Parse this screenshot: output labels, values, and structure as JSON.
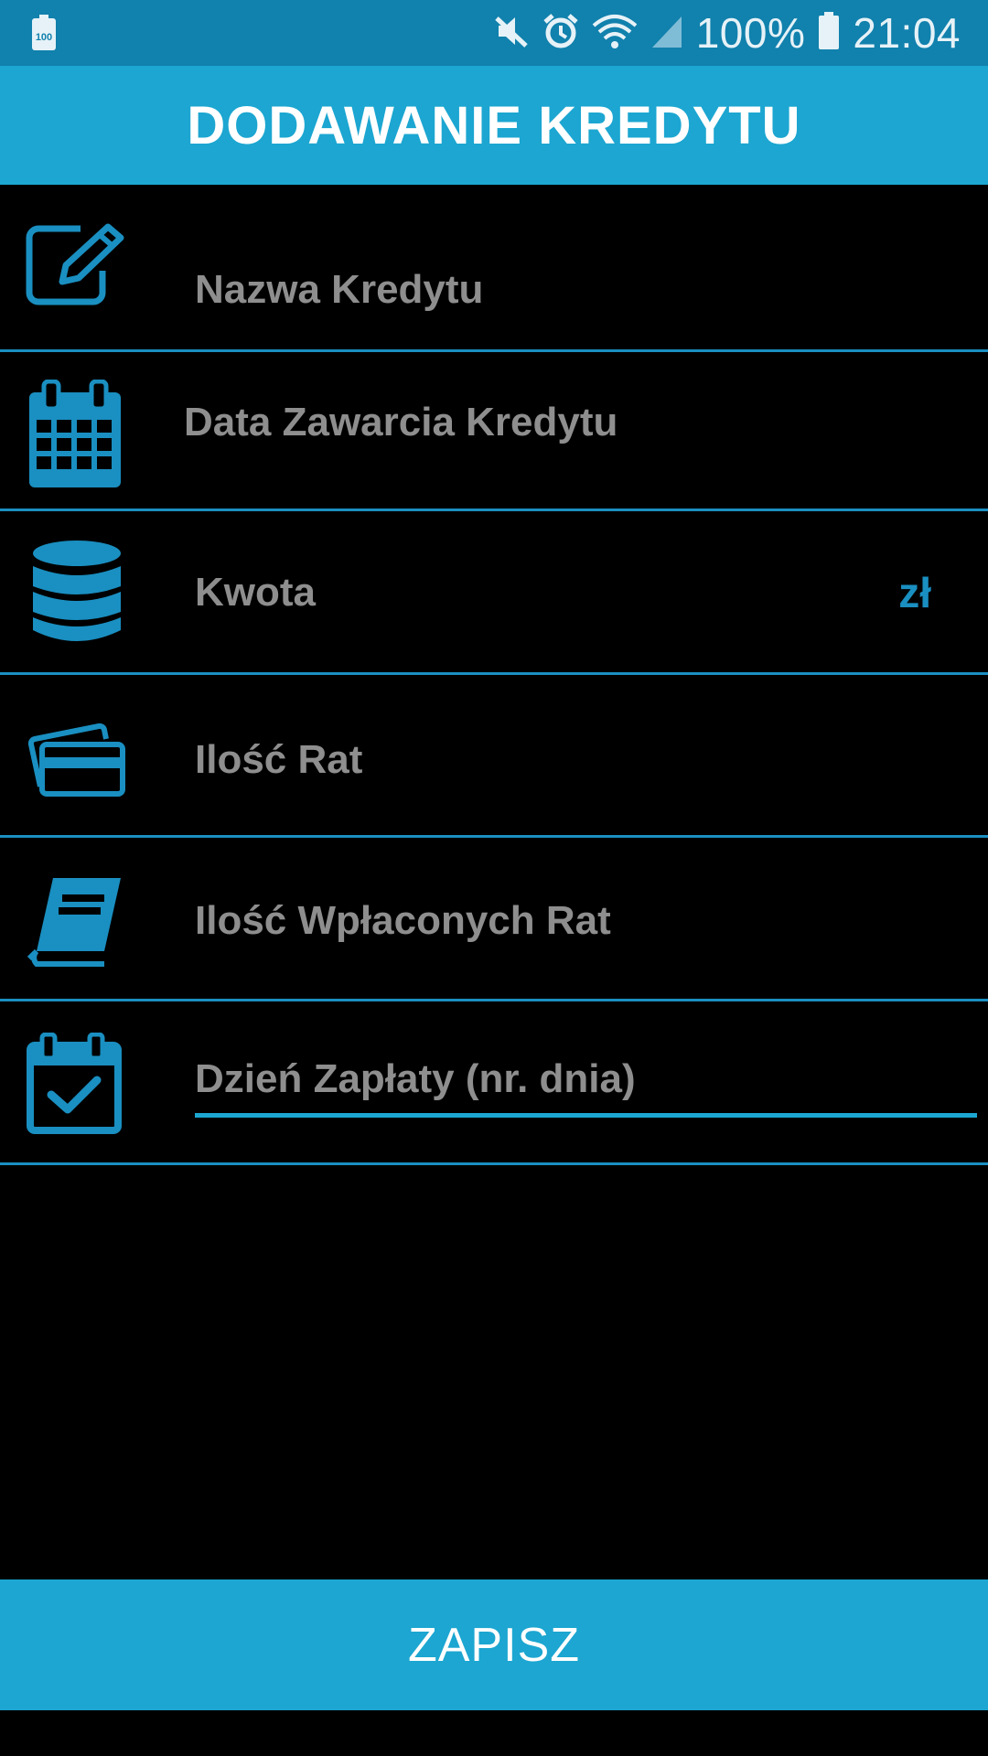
{
  "status_bar": {
    "battery_badge": "100",
    "battery_percent": "100%",
    "time": "21:04",
    "icons": [
      "battery-saver-icon",
      "mute-icon",
      "alarm-icon",
      "wifi-icon",
      "signal-icon",
      "battery-icon"
    ]
  },
  "header": {
    "title": "DODAWANIE KREDYTU"
  },
  "form": {
    "fields": [
      {
        "icon": "edit-icon",
        "label": "Nazwa Kredytu"
      },
      {
        "icon": "calendar-icon",
        "label": "Data Zawarcia Kredytu"
      },
      {
        "icon": "coin-stack-icon",
        "label": "Kwota",
        "suffix": "zł"
      },
      {
        "icon": "cards-icon",
        "label": "Ilość Rat"
      },
      {
        "icon": "book-icon",
        "label": "Ilość Wpłaconych Rat"
      },
      {
        "icon": "calendar-check-icon",
        "label": "Dzień Zapłaty (nr. dnia)",
        "focused": true
      }
    ]
  },
  "footer": {
    "save_label": "ZAPISZ"
  },
  "colors": {
    "accent": "#1ca6d1",
    "status_bar": "#1181ad",
    "divider": "#1a8fc1",
    "label": "#8e8e8e",
    "background": "#000000"
  }
}
